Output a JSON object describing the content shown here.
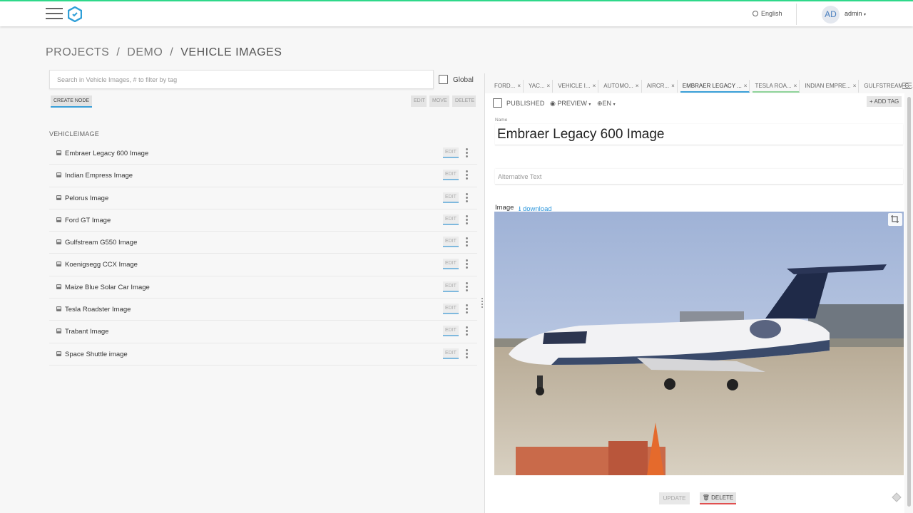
{
  "header": {
    "language": "English",
    "avatar_initials": "AD",
    "username": "admin",
    "accent_color": "#2fd88a"
  },
  "breadcrumb": {
    "items": [
      "PROJECTS",
      "DEMO",
      "VEHICLE IMAGES"
    ],
    "separator": "/"
  },
  "left": {
    "search_placeholder": "Search in Vehicle Images, # to filter by tag",
    "global_label": "Global",
    "create_label": "CREATE NODE",
    "edit_label": "EDIT",
    "move_label": "MOVE",
    "delete_label": "DELETE",
    "group_label": "VEHICLEIMAGE",
    "nodes": [
      "Embraer Legacy 600 Image",
      "Indian Empress Image",
      "Pelorus Image",
      "Ford GT Image",
      "Gulfstream G550 Image",
      "Koenigsegg CCX Image",
      "Maize Blue Solar Car Image",
      "Tesla Roadster Image",
      "Trabant Image",
      "Space Shuttle image"
    ],
    "node_edit_label": "EDIT"
  },
  "tabs": [
    {
      "label": "FORD...",
      "close": "×"
    },
    {
      "label": "YAC...",
      "close": "×"
    },
    {
      "label": "VEHICLE I...",
      "close": "×"
    },
    {
      "label": "AUTOMO...",
      "close": "×"
    },
    {
      "label": "AIRCR...",
      "close": "×"
    },
    {
      "label": "EMBRAER LEGACY ...",
      "close": "×"
    },
    {
      "label": "TESLA ROA...",
      "close": "×"
    },
    {
      "label": "INDIAN EMPRE...",
      "close": "×"
    },
    {
      "label": "GULFSTREAM G...",
      "close": "×"
    }
  ],
  "editor": {
    "published_label": "PUBLISHED",
    "preview_label": "PREVIEW",
    "language_label": "EN",
    "add_tag_label": "+ ADD TAG",
    "name_label": "Name",
    "name_value": "Embraer Legacy 600 Image",
    "alt_placeholder": "Alternative Text",
    "image_label": "Image",
    "download_label": "download",
    "update_label": "UPDATE",
    "delete_label": "DELETE"
  }
}
